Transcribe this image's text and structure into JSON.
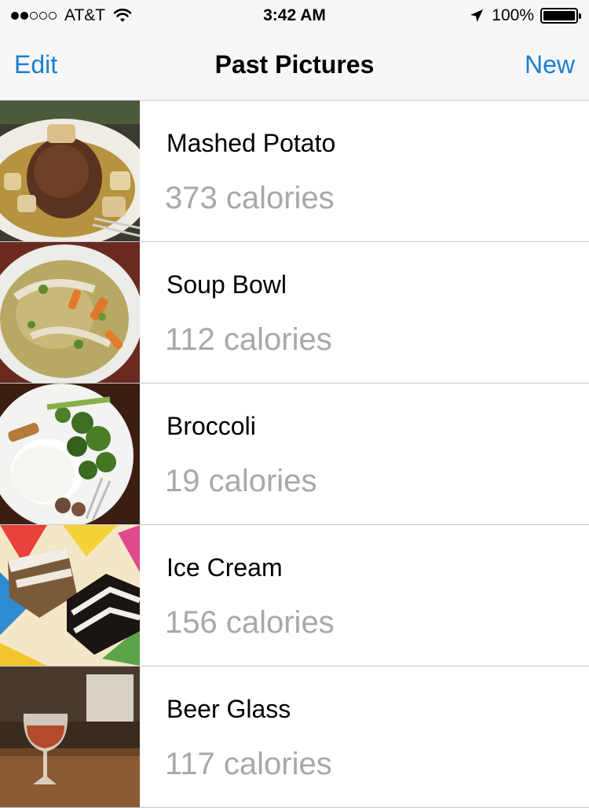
{
  "status": {
    "carrier": "AT&T",
    "signal_filled": 2,
    "signal_total": 5,
    "time": "3:42 AM",
    "battery_text": "100%",
    "battery_level": 1.0
  },
  "nav": {
    "left": "Edit",
    "title": "Past Pictures",
    "right": "New"
  },
  "colors": {
    "accent": "#1a7fd4",
    "secondary_text": "#a8a8ac",
    "bar_bg": "#f7f7f7",
    "separator": "#c8c7cc"
  },
  "items": [
    {
      "title": "Mashed Potato",
      "calories": "373 calories",
      "thumbnail": "plate-meat-potatoes"
    },
    {
      "title": "Soup Bowl",
      "calories": "112 calories",
      "thumbnail": "soup-bowl"
    },
    {
      "title": "Broccoli",
      "calories": "19 calories",
      "thumbnail": "broccoli-rice-plate"
    },
    {
      "title": "Ice Cream",
      "calories": "156 calories",
      "thumbnail": "cake-slices"
    },
    {
      "title": "Beer Glass",
      "calories": "117 calories",
      "thumbnail": "beer-glass"
    }
  ]
}
